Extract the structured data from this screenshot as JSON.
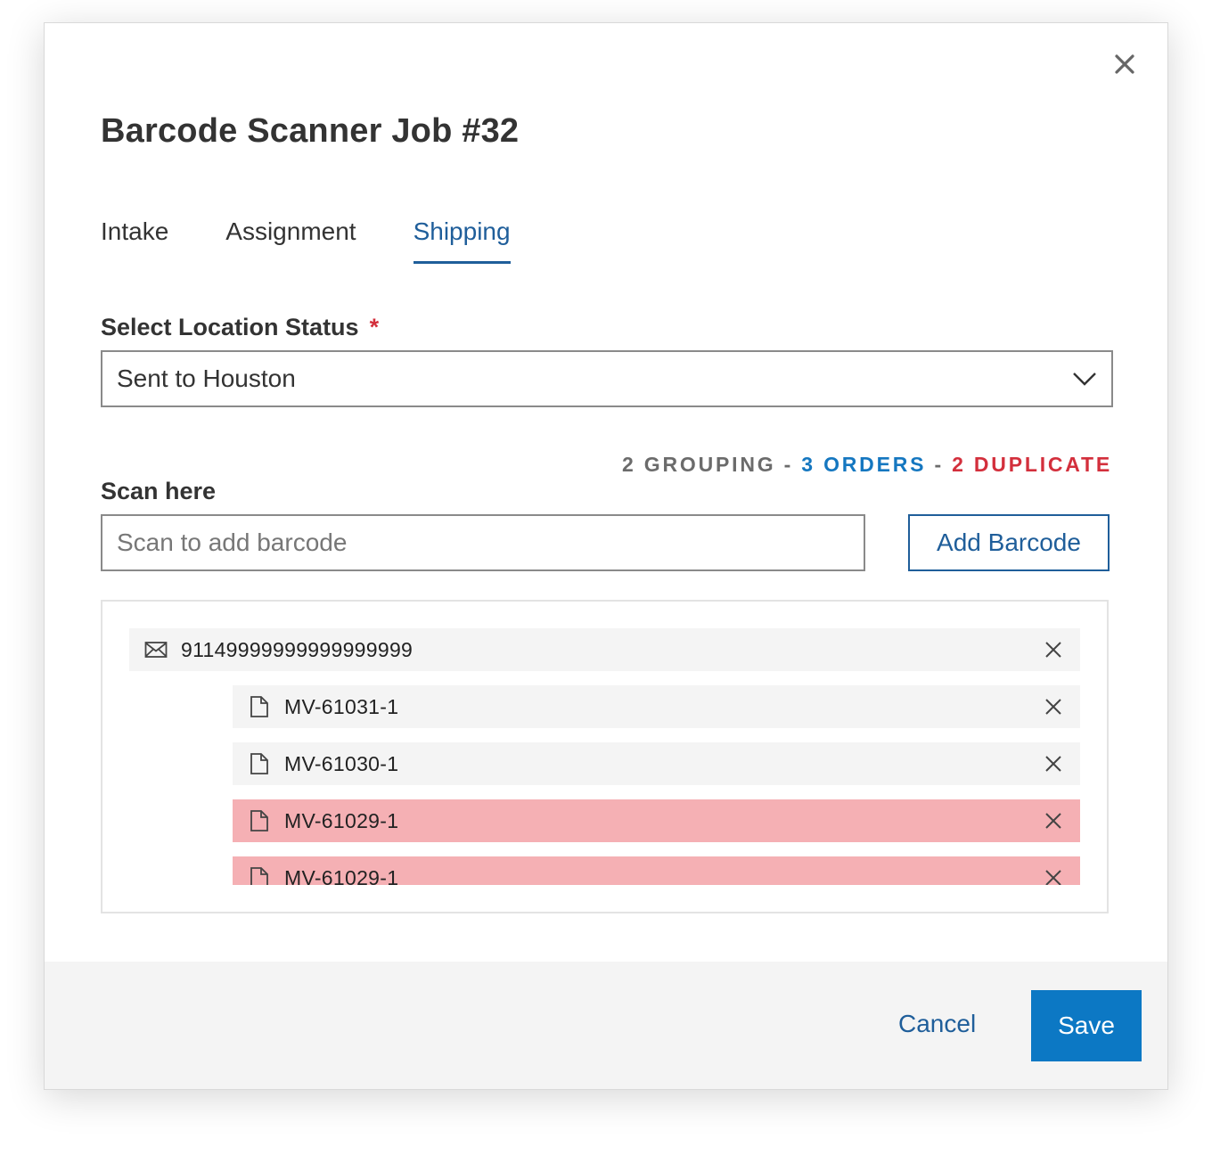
{
  "dialog": {
    "title": "Barcode Scanner Job #32",
    "close_icon": "close-icon"
  },
  "tabs": [
    {
      "label": "Intake",
      "active": false
    },
    {
      "label": "Assignment",
      "active": false
    },
    {
      "label": "Shipping",
      "active": true
    }
  ],
  "location_status": {
    "label": "Select Location Status",
    "required_marker": "*",
    "selected_value": "Sent to Houston",
    "icon": "chevron-down-icon"
  },
  "counts": {
    "grouping": "2 GROUPING",
    "sep1": " - ",
    "orders": "3 ORDERS",
    "sep2": " - ",
    "duplicate": "2 DUPLICATE"
  },
  "scan": {
    "label": "Scan here",
    "placeholder": "Scan to add barcode",
    "value": "",
    "add_button": "Add Barcode"
  },
  "items": [
    {
      "code": "91149999999999999999",
      "icon": "envelope-icon",
      "duplicate": false
    },
    {
      "code": "MV-61031-1",
      "icon": "document-icon",
      "duplicate": false
    },
    {
      "code": "MV-61030-1",
      "icon": "document-icon",
      "duplicate": false
    },
    {
      "code": "MV-61029-1",
      "icon": "document-icon",
      "duplicate": true
    },
    {
      "code": "MV-61029-1",
      "icon": "document-icon",
      "duplicate": true
    }
  ],
  "footer": {
    "cancel": "Cancel",
    "save": "Save"
  },
  "colors": {
    "accent": "#1f5e9a",
    "primary_button": "#0c78c4",
    "orders_blue": "#1577c0",
    "duplicate_red": "#d32f3c",
    "duplicate_row": "#f5b0b4"
  }
}
